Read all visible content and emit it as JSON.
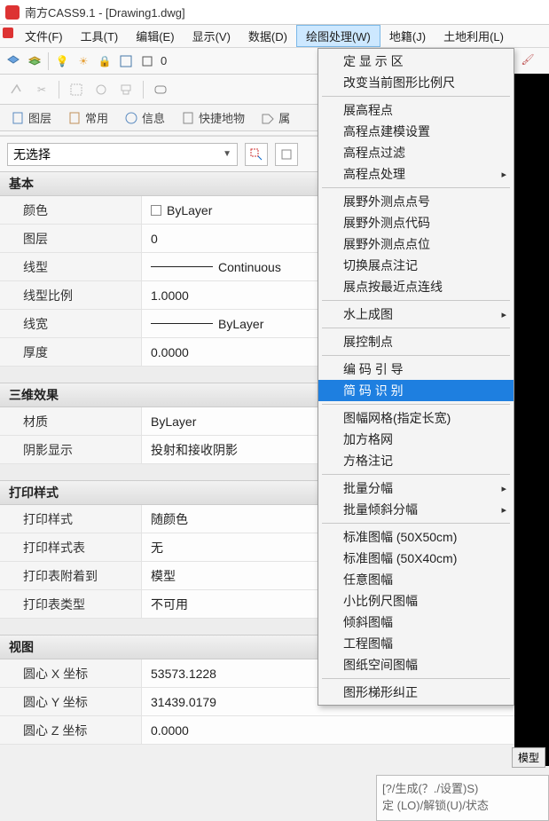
{
  "title": "南方CASS9.1 - [Drawing1.dwg]",
  "menu": {
    "items": [
      {
        "label": "文件(F)"
      },
      {
        "label": "工具(T)"
      },
      {
        "label": "编辑(E)"
      },
      {
        "label": "显示(V)"
      },
      {
        "label": "数据(D)"
      },
      {
        "label": "绘图处理(W)",
        "active": true
      },
      {
        "label": "地籍(J)"
      },
      {
        "label": "土地利用(L)"
      }
    ]
  },
  "toolbar1": {
    "layer_field": "0"
  },
  "tabs": [
    {
      "label": "图层"
    },
    {
      "label": "常用"
    },
    {
      "label": "信息"
    },
    {
      "label": "快捷地物"
    },
    {
      "label": "属"
    }
  ],
  "select": {
    "value": "无选择"
  },
  "sections": {
    "basic": {
      "title": "基本",
      "rows": [
        {
          "label": "颜色",
          "value": "ByLayer",
          "swatch": true
        },
        {
          "label": "图层",
          "value": "0"
        },
        {
          "label": "线型",
          "value": "Continuous",
          "line": true
        },
        {
          "label": "线型比例",
          "value": "1.0000"
        },
        {
          "label": "线宽",
          "value": "ByLayer",
          "line": true
        },
        {
          "label": "厚度",
          "value": "0.0000"
        }
      ]
    },
    "threeD": {
      "title": "三维效果",
      "rows": [
        {
          "label": "材质",
          "value": "ByLayer"
        },
        {
          "label": "阴影显示",
          "value": "投射和接收阴影"
        }
      ]
    },
    "print": {
      "title": "打印样式",
      "rows": [
        {
          "label": "打印样式",
          "value": "随颜色"
        },
        {
          "label": "打印样式表",
          "value": "无"
        },
        {
          "label": "打印表附着到",
          "value": "模型"
        },
        {
          "label": "打印表类型",
          "value": "不可用"
        }
      ]
    },
    "view": {
      "title": "视图",
      "rows": [
        {
          "label": "圆心 X 坐标",
          "value": "53573.1228"
        },
        {
          "label": "圆心 Y 坐标",
          "value": "31439.0179"
        },
        {
          "label": "圆心 Z 坐标",
          "value": "0.0000"
        }
      ]
    }
  },
  "dropdown": {
    "groups": [
      [
        {
          "label": "定 显 示 区"
        },
        {
          "label": "改变当前图形比例尺"
        }
      ],
      [
        {
          "label": "展高程点"
        },
        {
          "label": "高程点建模设置"
        },
        {
          "label": "高程点过滤"
        },
        {
          "label": "高程点处理",
          "sub": true
        }
      ],
      [
        {
          "label": "展野外测点点号"
        },
        {
          "label": "展野外测点代码"
        },
        {
          "label": "展野外测点点位"
        },
        {
          "label": "切换展点注记"
        },
        {
          "label": "展点按最近点连线"
        }
      ],
      [
        {
          "label": "水上成图",
          "sub": true
        }
      ],
      [
        {
          "label": "展控制点"
        }
      ],
      [
        {
          "label": "编 码 引 导"
        },
        {
          "label": "简 码 识 别",
          "hl": true
        }
      ],
      [
        {
          "label": "图幅网格(指定长宽)"
        },
        {
          "label": "加方格网"
        },
        {
          "label": "方格注记"
        }
      ],
      [
        {
          "label": "批量分幅",
          "sub": true
        },
        {
          "label": "批量倾斜分幅",
          "sub": true
        }
      ],
      [
        {
          "label": "标准图幅 (50X50cm)"
        },
        {
          "label": "标准图幅 (50X40cm)"
        },
        {
          "label": "任意图幅"
        },
        {
          "label": "小比例尺图幅"
        },
        {
          "label": "倾斜图幅"
        },
        {
          "label": "工程图幅"
        },
        {
          "label": "图纸空间图幅"
        }
      ],
      [
        {
          "label": "图形梯形纠正"
        }
      ]
    ]
  },
  "modeltab": "模型",
  "cmd": {
    "line1": "[?/生成(？./设置)S)",
    "line2": "定 (LO)/解锁(U)/状态"
  }
}
